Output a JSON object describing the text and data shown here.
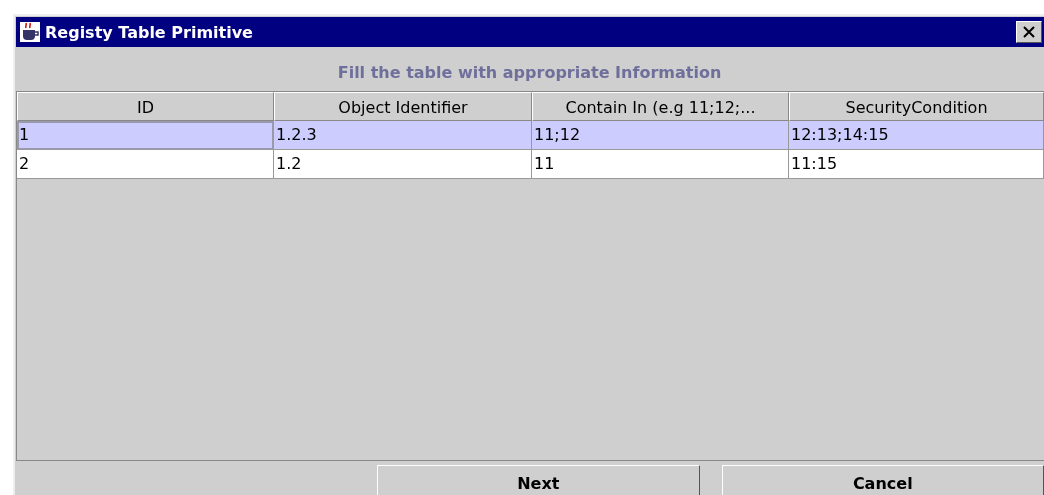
{
  "window": {
    "title": "Registy Table Primitive"
  },
  "instruction": "Fill the table with appropriate Information",
  "table": {
    "columns": [
      "ID",
      "Object Identifier",
      "Contain In (e.g 11;12;...",
      "SecurityCondition"
    ],
    "rows": [
      {
        "cells": [
          "1",
          "1.2.3",
          "11;12",
          "12:13;14:15"
        ],
        "selected": true
      },
      {
        "cells": [
          "2",
          "1.2",
          "11",
          "11:15"
        ],
        "selected": false
      }
    ]
  },
  "buttons": [
    "Next",
    "Cancel"
  ]
}
